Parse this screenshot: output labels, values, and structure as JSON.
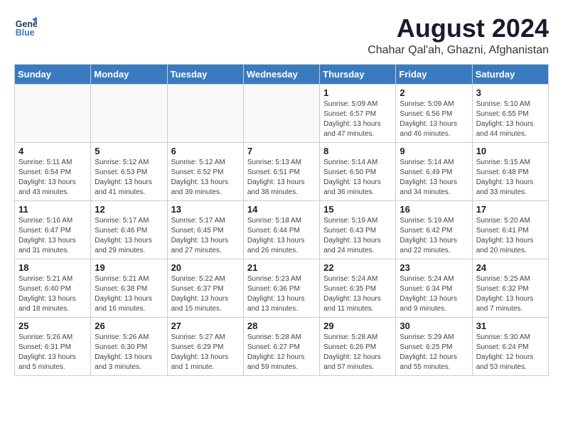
{
  "logo": {
    "line1": "General",
    "line2": "Blue"
  },
  "title": "August 2024",
  "subtitle": "Chahar Qal'ah, Ghazni, Afghanistan",
  "weekdays": [
    "Sunday",
    "Monday",
    "Tuesday",
    "Wednesday",
    "Thursday",
    "Friday",
    "Saturday"
  ],
  "weeks": [
    [
      {
        "day": "",
        "info": ""
      },
      {
        "day": "",
        "info": ""
      },
      {
        "day": "",
        "info": ""
      },
      {
        "day": "",
        "info": ""
      },
      {
        "day": "1",
        "info": "Sunrise: 5:09 AM\nSunset: 6:57 PM\nDaylight: 13 hours\nand 47 minutes."
      },
      {
        "day": "2",
        "info": "Sunrise: 5:09 AM\nSunset: 6:56 PM\nDaylight: 13 hours\nand 46 minutes."
      },
      {
        "day": "3",
        "info": "Sunrise: 5:10 AM\nSunset: 6:55 PM\nDaylight: 13 hours\nand 44 minutes."
      }
    ],
    [
      {
        "day": "4",
        "info": "Sunrise: 5:11 AM\nSunset: 6:54 PM\nDaylight: 13 hours\nand 43 minutes."
      },
      {
        "day": "5",
        "info": "Sunrise: 5:12 AM\nSunset: 6:53 PM\nDaylight: 13 hours\nand 41 minutes."
      },
      {
        "day": "6",
        "info": "Sunrise: 5:12 AM\nSunset: 6:52 PM\nDaylight: 13 hours\nand 39 minutes."
      },
      {
        "day": "7",
        "info": "Sunrise: 5:13 AM\nSunset: 6:51 PM\nDaylight: 13 hours\nand 38 minutes."
      },
      {
        "day": "8",
        "info": "Sunrise: 5:14 AM\nSunset: 6:50 PM\nDaylight: 13 hours\nand 36 minutes."
      },
      {
        "day": "9",
        "info": "Sunrise: 5:14 AM\nSunset: 6:49 PM\nDaylight: 13 hours\nand 34 minutes."
      },
      {
        "day": "10",
        "info": "Sunrise: 5:15 AM\nSunset: 6:48 PM\nDaylight: 13 hours\nand 33 minutes."
      }
    ],
    [
      {
        "day": "11",
        "info": "Sunrise: 5:16 AM\nSunset: 6:47 PM\nDaylight: 13 hours\nand 31 minutes."
      },
      {
        "day": "12",
        "info": "Sunrise: 5:17 AM\nSunset: 6:46 PM\nDaylight: 13 hours\nand 29 minutes."
      },
      {
        "day": "13",
        "info": "Sunrise: 5:17 AM\nSunset: 6:45 PM\nDaylight: 13 hours\nand 27 minutes."
      },
      {
        "day": "14",
        "info": "Sunrise: 5:18 AM\nSunset: 6:44 PM\nDaylight: 13 hours\nand 26 minutes."
      },
      {
        "day": "15",
        "info": "Sunrise: 5:19 AM\nSunset: 6:43 PM\nDaylight: 13 hours\nand 24 minutes."
      },
      {
        "day": "16",
        "info": "Sunrise: 5:19 AM\nSunset: 6:42 PM\nDaylight: 13 hours\nand 22 minutes."
      },
      {
        "day": "17",
        "info": "Sunrise: 5:20 AM\nSunset: 6:41 PM\nDaylight: 13 hours\nand 20 minutes."
      }
    ],
    [
      {
        "day": "18",
        "info": "Sunrise: 5:21 AM\nSunset: 6:40 PM\nDaylight: 13 hours\nand 18 minutes."
      },
      {
        "day": "19",
        "info": "Sunrise: 5:21 AM\nSunset: 6:38 PM\nDaylight: 13 hours\nand 16 minutes."
      },
      {
        "day": "20",
        "info": "Sunrise: 5:22 AM\nSunset: 6:37 PM\nDaylight: 13 hours\nand 15 minutes."
      },
      {
        "day": "21",
        "info": "Sunrise: 5:23 AM\nSunset: 6:36 PM\nDaylight: 13 hours\nand 13 minutes."
      },
      {
        "day": "22",
        "info": "Sunrise: 5:24 AM\nSunset: 6:35 PM\nDaylight: 13 hours\nand 11 minutes."
      },
      {
        "day": "23",
        "info": "Sunrise: 5:24 AM\nSunset: 6:34 PM\nDaylight: 13 hours\nand 9 minutes."
      },
      {
        "day": "24",
        "info": "Sunrise: 5:25 AM\nSunset: 6:32 PM\nDaylight: 13 hours\nand 7 minutes."
      }
    ],
    [
      {
        "day": "25",
        "info": "Sunrise: 5:26 AM\nSunset: 6:31 PM\nDaylight: 13 hours\nand 5 minutes."
      },
      {
        "day": "26",
        "info": "Sunrise: 5:26 AM\nSunset: 6:30 PM\nDaylight: 13 hours\nand 3 minutes."
      },
      {
        "day": "27",
        "info": "Sunrise: 5:27 AM\nSunset: 6:29 PM\nDaylight: 13 hours\nand 1 minute."
      },
      {
        "day": "28",
        "info": "Sunrise: 5:28 AM\nSunset: 6:27 PM\nDaylight: 12 hours\nand 59 minutes."
      },
      {
        "day": "29",
        "info": "Sunrise: 5:28 AM\nSunset: 6:26 PM\nDaylight: 12 hours\nand 57 minutes."
      },
      {
        "day": "30",
        "info": "Sunrise: 5:29 AM\nSunset: 6:25 PM\nDaylight: 12 hours\nand 55 minutes."
      },
      {
        "day": "31",
        "info": "Sunrise: 5:30 AM\nSunset: 6:24 PM\nDaylight: 12 hours\nand 53 minutes."
      }
    ]
  ]
}
